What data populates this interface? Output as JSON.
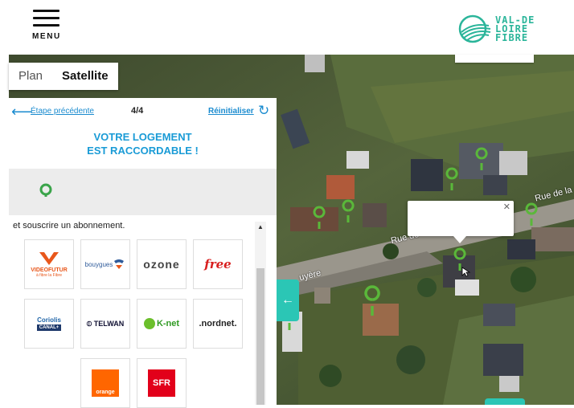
{
  "header": {
    "menu_label": "MENU",
    "logo_lines": [
      "VAL-DE",
      "LOIRE",
      "FIBRE"
    ]
  },
  "map_type": {
    "options": [
      "Plan",
      "Satellite"
    ],
    "selected": "Satellite"
  },
  "panel": {
    "prev_label": "Étape précédente",
    "step": "4/4",
    "reset_label": "Réinitialiser",
    "title_line1": "VOTRE LOGEMENT",
    "title_line2": "EST RACCORDABLE !",
    "subscribe_text": "et souscrire un abonnement.",
    "operators": [
      {
        "name": "VIDEOFUTUR",
        "sub": "à fibre la Fibre"
      },
      {
        "name": "bouygues"
      },
      {
        "name": "ozone"
      },
      {
        "name": "free"
      },
      {
        "name": "Coriolis",
        "sub": "CANAL+"
      },
      {
        "name": "TELWAN"
      },
      {
        "name": "K-net"
      },
      {
        "name": ".nordnet."
      },
      {
        "name": "orange"
      },
      {
        "name": "SFR"
      }
    ]
  },
  "map_labels": {
    "road1": "Rue de la",
    "road2": "Rue de",
    "road3": "uyère"
  },
  "colors": {
    "accent": "#1a9bd6",
    "teal": "#2bc6b5",
    "marker": "#5ab83a"
  },
  "icons": {
    "back": "arrow-left-icon",
    "reset": "refresh-icon",
    "collapse": "arrow-left-icon",
    "close": "close-icon",
    "marker": "map-marker-icon"
  }
}
